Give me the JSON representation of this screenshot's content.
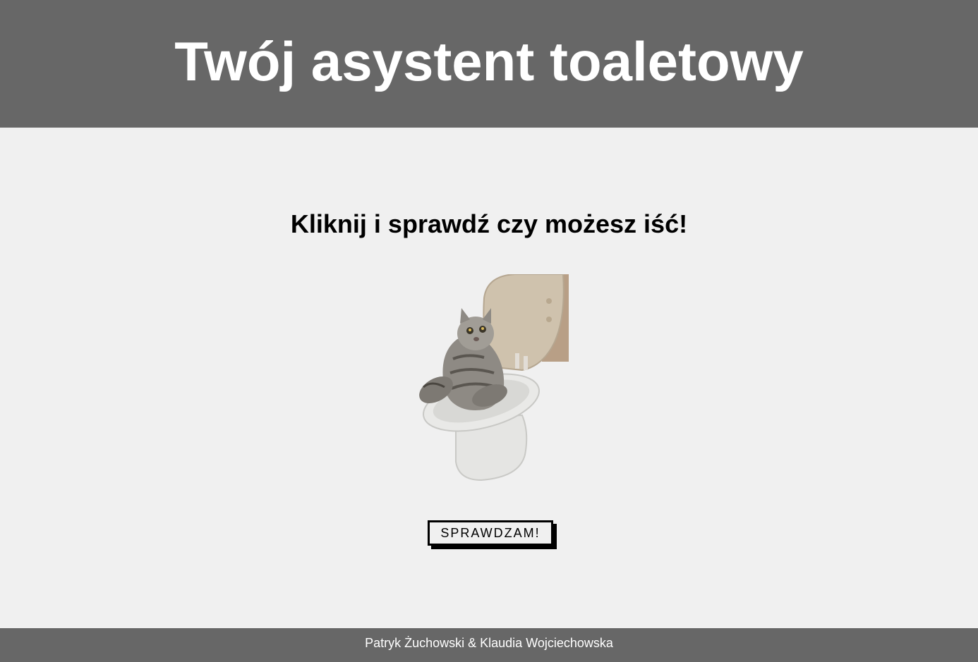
{
  "header": {
    "title": "Twój asystent toaletowy"
  },
  "main": {
    "prompt": "Kliknij i sprawdź czy możesz iść!",
    "illustration_subject": "cat-on-toilet-image",
    "button_label": "SPRAWDZAM!"
  },
  "footer": {
    "authors": "Patryk Żuchowski & Klaudia Wojciechowska"
  },
  "colors": {
    "header_bg": "#676767",
    "page_bg": "#f0f0f0",
    "footer_bg": "#676767",
    "title_text": "#ffffff",
    "prompt_text": "#000000"
  }
}
